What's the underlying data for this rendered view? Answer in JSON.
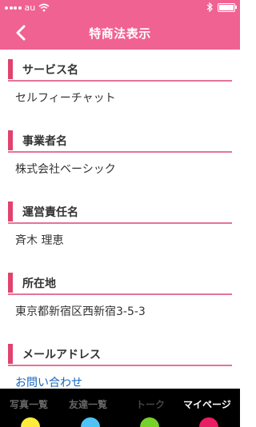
{
  "status_bar": {
    "carrier": "au",
    "time": ""
  },
  "nav": {
    "title": "特商法表示",
    "back_icon": "chevron-left-icon"
  },
  "sections": [
    {
      "title": "サービス名",
      "value": "セルフィーチャット"
    },
    {
      "title": "事業者名",
      "value": "株式会社ベーシック"
    },
    {
      "title": "運営責任名",
      "value": "斉木 理恵"
    },
    {
      "title": "所在地",
      "value": "東京都新宿区西新宿3-5-3"
    },
    {
      "title": "メールアドレス",
      "value": "お問い合わせ"
    }
  ],
  "tabs": [
    {
      "label": "写真一覧"
    },
    {
      "label": "友達一覧"
    },
    {
      "label": "トーク"
    },
    {
      "label": "マイページ"
    }
  ],
  "colors": {
    "brand_pink": "#f06292",
    "accent_bar": "#e0436e",
    "link_blue": "#1565c0",
    "tab_dots": [
      "#ffeb3b",
      "#4fc3f7",
      "#76d12a",
      "#e91e63"
    ]
  }
}
